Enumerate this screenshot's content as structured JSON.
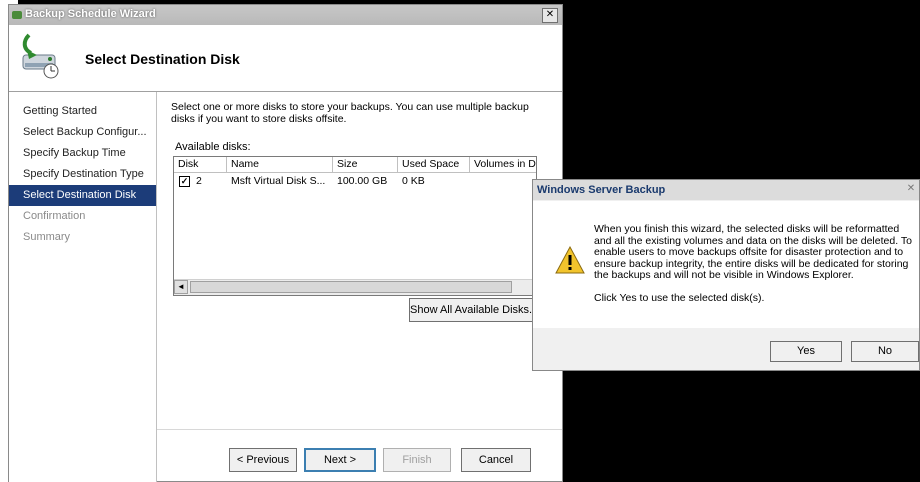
{
  "wizard": {
    "title": "Backup Schedule Wizard",
    "close_glyph": "✕",
    "header_title": "Select Destination Disk",
    "nav": [
      {
        "label": "Getting Started",
        "state": "normal"
      },
      {
        "label": "Select Backup Configur...",
        "state": "normal"
      },
      {
        "label": "Specify Backup Time",
        "state": "normal"
      },
      {
        "label": "Specify Destination Type",
        "state": "normal"
      },
      {
        "label": "Select Destination Disk",
        "state": "active"
      },
      {
        "label": "Confirmation",
        "state": "disabled"
      },
      {
        "label": "Summary",
        "state": "disabled"
      }
    ],
    "description": "Select one or more disks to store your backups. You can use multiple backup disks if you want to store disks offsite.",
    "available_label": "Available disks:",
    "columns": [
      "Disk",
      "Name",
      "Size",
      "Used Space",
      "Volumes in Dis"
    ],
    "rows": [
      {
        "checked": true,
        "check_glyph": "✓",
        "disk": "2",
        "name": "Msft Virtual Disk S...",
        "size": "100.00 GB",
        "used": "0 KB",
        "volumes": ""
      }
    ],
    "show_all_button": "Show All Available Disks...",
    "buttons": {
      "previous": "< Previous",
      "next": "Next >",
      "finish": "Finish",
      "cancel": "Cancel"
    },
    "scroll_left_glyph": "◄"
  },
  "dialog": {
    "title": "Windows Server Backup",
    "close_glyph": "✕",
    "message": "When you finish this wizard, the selected disks will be reformatted and all the existing volumes and data on the disks will be deleted. To enable users to move backups offsite for disaster protection and to ensure backup integrity, the entire disks will be dedicated for storing the backups and will not be visible in Windows Explorer.",
    "prompt": "Click Yes to use the selected disk(s).",
    "yes": "Yes",
    "no": "No"
  },
  "colors": {
    "selection": "#1c3c79",
    "warning": "#f2c42c"
  }
}
